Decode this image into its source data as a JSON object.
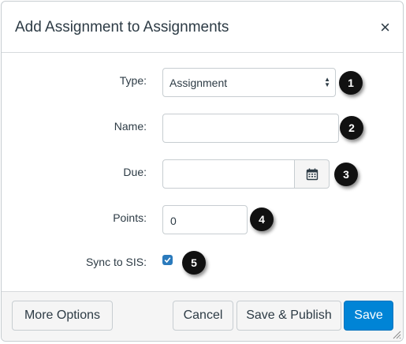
{
  "dialog": {
    "title": "Add Assignment to Assignments",
    "close_symbol": "×"
  },
  "form": {
    "type_label": "Type:",
    "type_value": "Assignment",
    "name_label": "Name:",
    "name_value": "",
    "due_label": "Due:",
    "due_value": "",
    "points_label": "Points:",
    "points_value": "0",
    "sync_label": "Sync to SIS:",
    "sync_checked": true
  },
  "callouts": [
    "1",
    "2",
    "3",
    "4",
    "5"
  ],
  "footer": {
    "more_options": "More Options",
    "cancel": "Cancel",
    "save_publish": "Save & Publish",
    "save": "Save"
  },
  "colors": {
    "primary": "#0084d6",
    "checkbox": "#2a7abc",
    "text": "#2d3b45",
    "callout": "#111111"
  },
  "icons": {
    "close": "close-icon",
    "select_arrows": "select-arrows-icon",
    "calendar": "calendar-icon",
    "checkmark": "checkmark-icon",
    "resize": "resize-grip-icon"
  }
}
